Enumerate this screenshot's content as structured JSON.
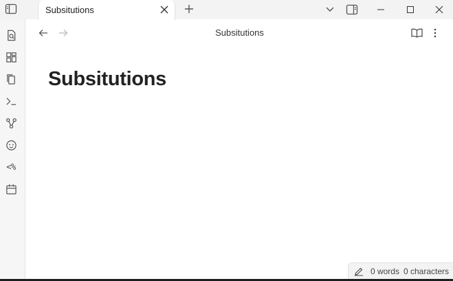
{
  "tab": {
    "title": "Subsitutions"
  },
  "view": {
    "title": "Subsitutions"
  },
  "note": {
    "title": "Subsitutions"
  },
  "ribbon": {
    "items": [
      {
        "icon": "quick-switcher-icon"
      },
      {
        "icon": "canvas-icon"
      },
      {
        "icon": "templates-icon"
      },
      {
        "icon": "command-palette-icon"
      },
      {
        "icon": "graph-icon"
      },
      {
        "icon": "plugin-icon"
      },
      {
        "icon": "templater-icon",
        "label": "<%"
      },
      {
        "icon": "calendar-icon"
      }
    ]
  },
  "status": {
    "words": "0 words",
    "characters": "0 characters"
  },
  "colors": {
    "accent": "#222222",
    "chrome": "#f3f3f3",
    "background": "#ffffff"
  }
}
